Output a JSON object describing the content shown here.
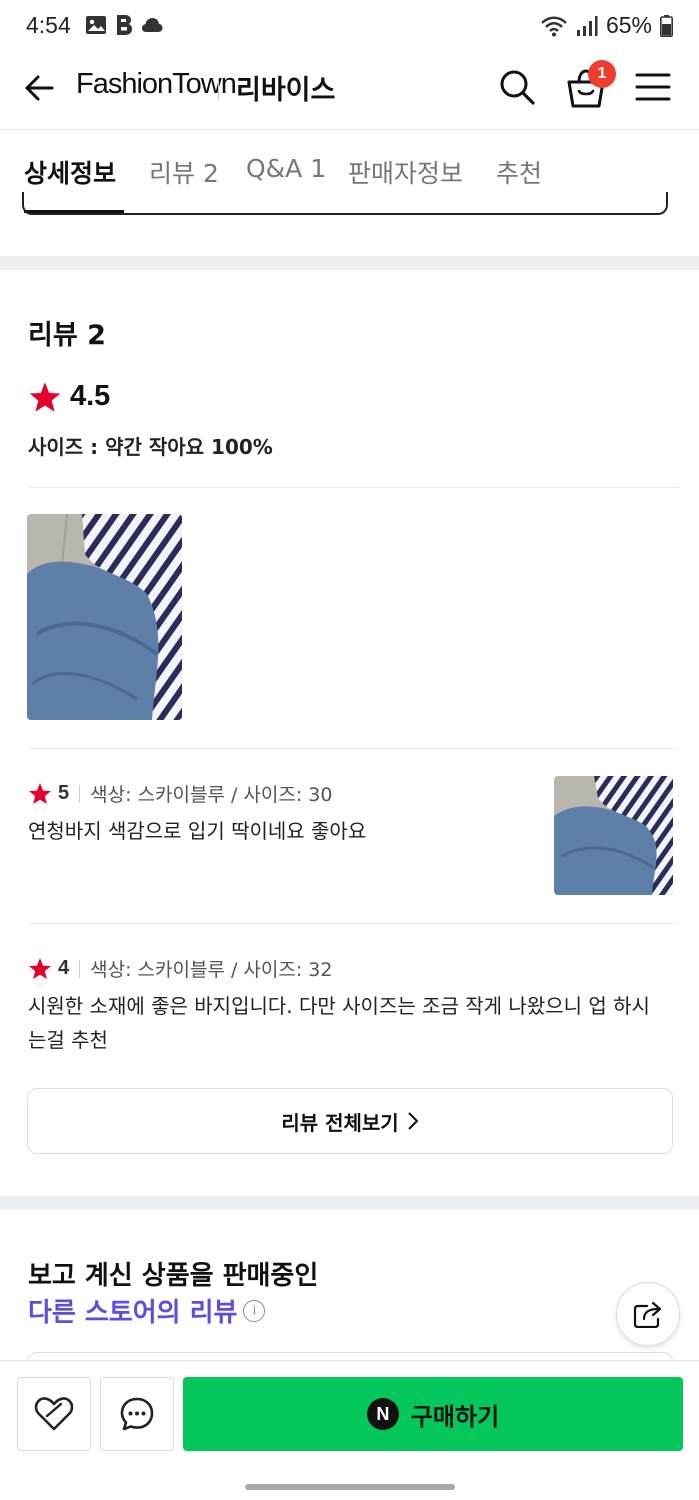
{
  "status_bar": {
    "time": "4:54",
    "battery": "65%"
  },
  "header": {
    "brand": "FashionTown",
    "store": "리바이스",
    "cart_count": "1"
  },
  "tabs": [
    {
      "label": "상세정보",
      "active": true
    },
    {
      "label": "리뷰 2",
      "active": false
    },
    {
      "label": "Q&A 1",
      "active": false
    },
    {
      "label": "판매자정보",
      "active": false
    },
    {
      "label": "추천",
      "active": false
    }
  ],
  "reviews": {
    "title": "리뷰 2",
    "average": "4.5",
    "size_summary": "사이즈 : 약간 작아요 100%",
    "items": [
      {
        "score": "5",
        "option": "색상: 스카이블루 / 사이즈: 30",
        "text": "연청바지 색감으로 입기 딱이네요 좋아요"
      },
      {
        "score": "4",
        "option": "색상: 스카이블루 / 사이즈: 32",
        "text": "시원한 소재에 좋은 바지입니다. 다만 사이즈는 조금 작게 나왔으니 업 하시는걸 추천"
      }
    ],
    "all_button": "리뷰 전체보기"
  },
  "promo": {
    "title": "보고 계신 상품을 판매중인",
    "subtitle": "다른 스토어의 리뷰"
  },
  "bottom": {
    "buy_label": "구매하기",
    "npay_glyph": "N"
  },
  "colors": {
    "star": "#e4002b",
    "accent": "#5b4de0",
    "buy": "#03c75a",
    "badge": "#f03b2f"
  }
}
